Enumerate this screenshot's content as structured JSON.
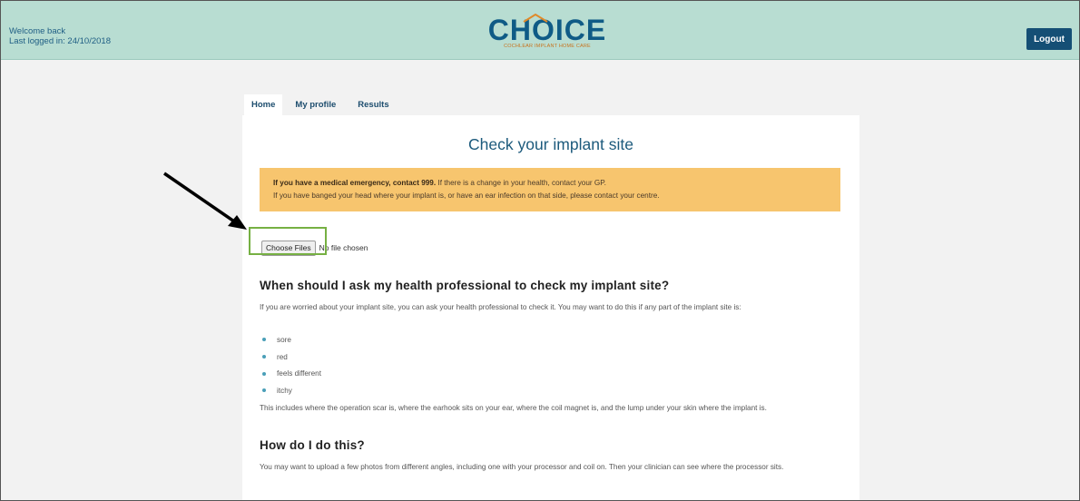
{
  "header": {
    "welcome_line1": "Welcome back",
    "welcome_line2": "Last logged in: 24/10/2018",
    "logo_main": "CHOICE",
    "logo_sub": "COCHLEAR IMPLANT HOME CARE",
    "logout_label": "Logout"
  },
  "tabs": [
    {
      "label": "Home",
      "active": true
    },
    {
      "label": "My profile",
      "active": false
    },
    {
      "label": "Results",
      "active": false
    }
  ],
  "main": {
    "title": "Check your implant site",
    "alert": {
      "line1_bold": "If you have a medical emergency, contact 999.",
      "line1_rest": " If there is a change in your health, contact your GP.",
      "line2": "If you have banged your head where your implant is, or have an ear infection on that side, please contact your centre."
    },
    "file_input": {
      "button_label": "Choose Files",
      "status": "No file chosen"
    },
    "section1": {
      "heading": "When should I ask my health professional to check my implant site?",
      "intro": "If you are worried about your implant site, you can ask your health professional to check it. You may want to do this if any part of the implant site is:",
      "bullets": [
        "sore",
        "red",
        "feels different",
        "itchy"
      ],
      "outro": "This includes where the operation scar is, where the earhook sits on your ear, where the coil magnet is, and the lump under your skin where the implant is."
    },
    "section2": {
      "heading": "How do I do this?",
      "para": "You may want to upload a few photos from different angles, including one with your processor and coil on. Then your clinician can see where the processor sits."
    }
  },
  "colors": {
    "header_bg": "#b8ddd2",
    "brand_blue": "#0f5b86",
    "logout_bg": "#154f75",
    "alert_bg": "#f7c56e",
    "highlight": "#76b043",
    "bullet": "#4a9fb8"
  }
}
